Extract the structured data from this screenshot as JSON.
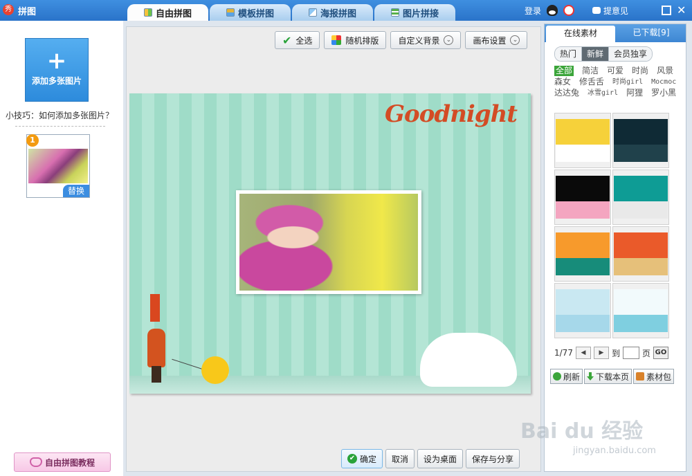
{
  "titlebar": {
    "app_logo": "秀",
    "app_title": "拼图",
    "tabs": [
      {
        "label": "自由拼图",
        "icon": "free-collage-icon"
      },
      {
        "label": "模板拼图",
        "icon": "template-collage-icon"
      },
      {
        "label": "海报拼图",
        "icon": "poster-collage-icon"
      },
      {
        "label": "图片拼接",
        "icon": "image-join-icon"
      }
    ],
    "login": "登录",
    "feedback": "提意见"
  },
  "sidebar": {
    "add_plus": "+",
    "add_label": "添加多张图片",
    "tip": "小技巧：如何添加多张图片？",
    "thumb_number": "1",
    "thumb_replace": "替换",
    "tutorial_label": "自由拼图教程"
  },
  "toolbar": {
    "select_all": "全选",
    "random_layout": "随机排版",
    "custom_bg": "自定义背景",
    "canvas_settings": "画布设置"
  },
  "canvas": {
    "headline": "Goodnight"
  },
  "bottom_bar": {
    "confirm": "确定",
    "cancel": "取消",
    "set_desktop": "设为桌面",
    "save_share": "保存与分享"
  },
  "right_panel": {
    "tab_online": "在线素材",
    "tab_downloaded": "已下载[9]",
    "subtabs": [
      "热门",
      "新鲜",
      "会员独享"
    ],
    "tags": [
      "全部",
      "简洁",
      "可爱",
      "时尚",
      "风景",
      "森女",
      "修舌舌",
      "时尚girl",
      "Mocmoc",
      "达达兔",
      "冰雪girl",
      "阿狸",
      "罗小黑"
    ],
    "template_colors": [
      [
        "#f6d13a",
        "#ffffff"
      ],
      [
        "#0f2a35",
        "#20414b"
      ],
      [
        "#0a0a0a",
        "#f4a5c0"
      ],
      [
        "#0e9c95",
        "#e9e9e9"
      ],
      [
        "#f79a2c",
        "#178c7a"
      ],
      [
        "#ea5a2a",
        "#e6c07a"
      ],
      [
        "#c9e8f2",
        "#a6d8ea"
      ],
      [
        "#f2fafc",
        "#7fcfe0"
      ]
    ],
    "pager": {
      "current": "1/77",
      "to": "到",
      "page": "页",
      "go": "GO"
    },
    "refresh": "刷新",
    "download_page": "下载本页",
    "material_pack": "素材包"
  },
  "watermark": {
    "main": "Bai du 经验",
    "sub": "jingyan.baidu.com"
  }
}
